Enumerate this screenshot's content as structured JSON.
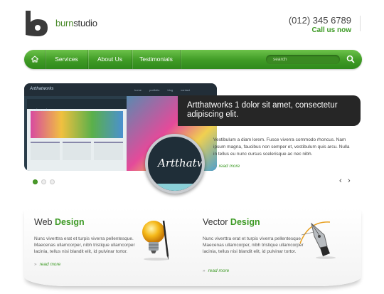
{
  "header": {
    "brand_part1": "burn",
    "brand_part2": "studio",
    "phone": "(012) 345 6789",
    "call_label": "Call us now"
  },
  "nav": {
    "home_icon": "home-icon",
    "items": [
      {
        "label": "Services"
      },
      {
        "label": "About Us"
      },
      {
        "label": "Testimonials"
      }
    ],
    "search_placeholder": "search",
    "search_icon": "search-icon"
  },
  "slider": {
    "screenshot_logo": "Artthatworks",
    "screenshot_nav": [
      "home",
      "portfolio",
      "blog",
      "contact"
    ],
    "caption": "Artthatworks 1 dolor sit amet, consectetur adipiscing elit.",
    "magnifier_text": "Artthatw",
    "description": "Vestibulum a diam lorem. Fusce viverra commodo rhoncus. Nam ipsum magna, faucibus non semper et, vestibulum quis arcu. Nulla in tellus eu nunc cursus scelerisque ac nec nibh.",
    "read_more": "read more",
    "pager": {
      "count": 3,
      "active": 1
    },
    "prev_glyph": "‹",
    "next_glyph": "›"
  },
  "panels": [
    {
      "title_plain": "Web ",
      "title_accent": "Design",
      "text": "Nunc viverttra erat et turpis viverra pellentesque. Maecenas ullamcorper, nibh tristique ullamcorper lacinia, tellus nisi blandit elit, id pulvinar tortor.",
      "read_more": "read more",
      "icon": "lightbulb-icon"
    },
    {
      "title_plain": "Vector ",
      "title_accent": "Design",
      "text": "Nunc viverttra erat et turpis viverra pellentesque. Maecenas ullamcorper, nibh tristique ullamcorper lacinia, tellus nisi blandit elit, id pulvinar tortor.",
      "read_more": "read more",
      "icon": "pen-tool-icon"
    }
  ],
  "colors": {
    "accent_green": "#3d9a25",
    "nav_green": "#4aa42e",
    "dark": "#262626"
  }
}
